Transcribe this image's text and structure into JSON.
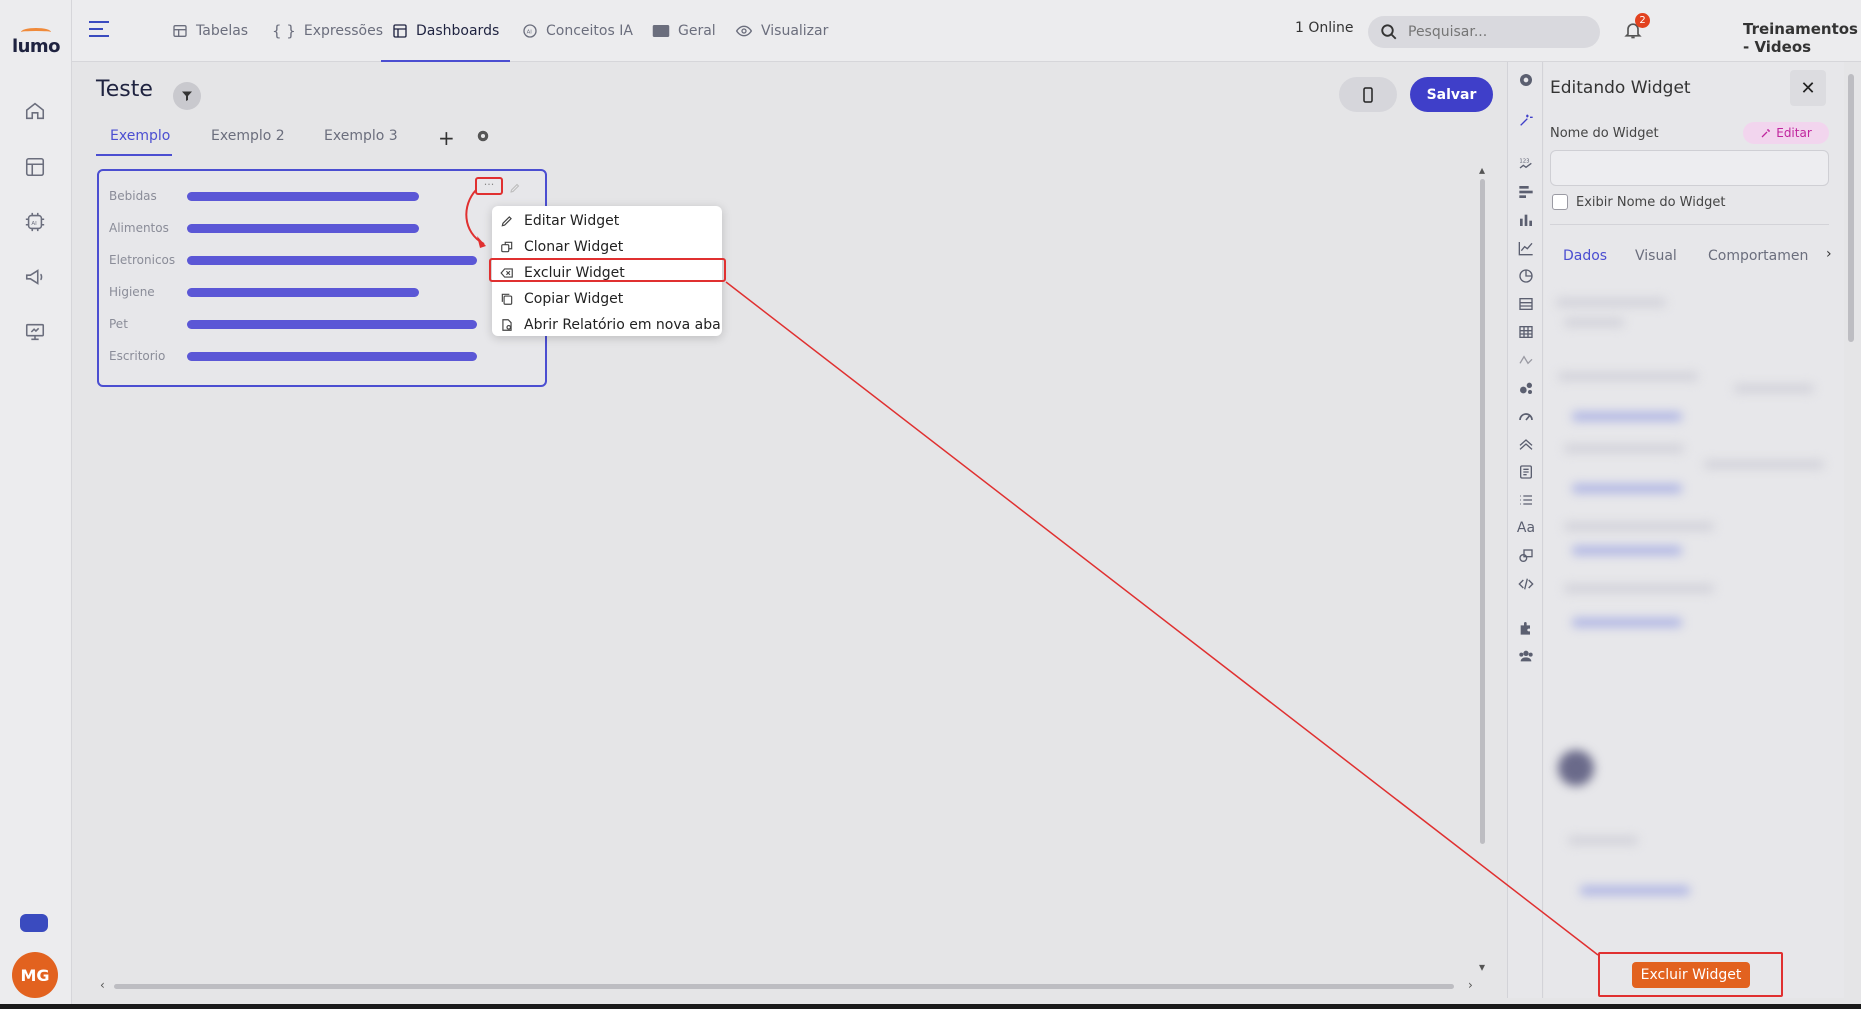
{
  "app": {
    "logo_text": "lumo"
  },
  "topnav": {
    "items": [
      {
        "label": "Tabelas",
        "icon": "table-icon"
      },
      {
        "label": "Expressões",
        "icon": "braces-icon"
      },
      {
        "label": "Dashboards",
        "icon": "dashboard-icon",
        "active": true
      },
      {
        "label": "Conceitos IA",
        "icon": "ai-icon"
      },
      {
        "label": "Geral",
        "icon": "folder-icon"
      },
      {
        "label": "Visualizar",
        "icon": "eye-icon"
      }
    ],
    "online_status": "1 Online",
    "search_placeholder": "Pesquisar...",
    "notification_count": "2",
    "workspace": "Treinamentos - Videos"
  },
  "sidebar": {
    "icons": [
      "home-icon",
      "dashboard-icon",
      "ai-chip-icon",
      "megaphone-icon",
      "presentation-icon"
    ],
    "avatar_initials": "MG"
  },
  "dashboard": {
    "title": "Teste",
    "tabs": [
      "Exemplo",
      "Exemplo 2",
      "Exemplo 3"
    ],
    "active_tab": "Exemplo",
    "save_label": "Salvar"
  },
  "widget": {
    "menu_dots": "···",
    "chart_data": {
      "type": "bar",
      "orientation": "horizontal",
      "categories": [
        "Bebidas",
        "Alimentos",
        "Eletronicos",
        "Higiene",
        "Pet",
        "Escritorio"
      ],
      "values": [
        0.8,
        0.8,
        1.0,
        0.8,
        1.0,
        1.0
      ],
      "title": "",
      "xlabel": "",
      "ylabel": "",
      "grid": false,
      "bar_color": "#5b57d6"
    }
  },
  "context_menu": {
    "items": [
      {
        "label": "Editar Widget",
        "icon": "pencil-icon"
      },
      {
        "label": "Clonar Widget",
        "icon": "clone-icon"
      },
      {
        "label": "Excluir Widget",
        "icon": "delete-icon",
        "highlighted": true
      },
      {
        "label": "Copiar Widget",
        "icon": "copy-icon"
      },
      {
        "label": "Abrir Relatório em nova aba",
        "icon": "open-report-icon"
      }
    ]
  },
  "right_panel": {
    "title": "Editando Widget",
    "close_label": "✕",
    "name_label": "Nome do Widget",
    "edit_label": "Editar",
    "show_name_label": "Exibir Nome do Widget",
    "tabs": [
      "Dados",
      "Visual",
      "Comportamen"
    ],
    "active_tab": "Dados",
    "delete_label": "Excluir Widget"
  },
  "colors": {
    "accent": "#4b4ed1",
    "save_button": "#3f3fc9",
    "delete_button": "#e2621f",
    "annotation": "#e03030"
  }
}
